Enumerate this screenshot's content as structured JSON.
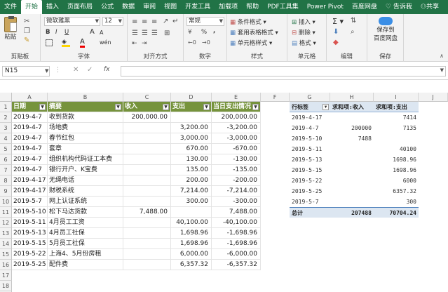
{
  "ribbon_tabs": [
    "文件",
    "开始",
    "插入",
    "页面布局",
    "公式",
    "数据",
    "审阅",
    "视图",
    "开发工具",
    "加载项",
    "帮助",
    "PDF工具集",
    "Power Pivot",
    "百度网盘",
    "告诉我",
    "共享"
  ],
  "ribbon": {
    "clipboard": {
      "paste": "粘贴",
      "label": "剪贴板"
    },
    "font": {
      "name": "微软雅黑",
      "size": "12",
      "label": "字体",
      "bold": "B",
      "italic": "I",
      "underline": "U",
      "grow": "A",
      "shrink": "A",
      "wen": "wén"
    },
    "alignment": {
      "label": "对齐方式"
    },
    "number": {
      "format": "常规",
      "label": "数字",
      "percent": "%",
      "comma": ","
    },
    "styles": {
      "cond": "条件格式",
      "table": "套用表格格式",
      "cell": "单元格样式",
      "label": "样式"
    },
    "cells": {
      "insert": "插入",
      "delete": "删除",
      "format": "格式",
      "label": "单元格"
    },
    "editing": {
      "label": "编辑",
      "sum": "Σ"
    },
    "baidu": {
      "save1": "保存到",
      "save2": "百度网盘",
      "label": "保存"
    }
  },
  "formula_bar": {
    "name_box": "N15",
    "fx": "fx",
    "value": ""
  },
  "columns": [
    "A",
    "B",
    "C",
    "D",
    "E",
    "F",
    "G",
    "H",
    "I",
    "J"
  ],
  "rows": [
    "1",
    "2",
    "3",
    "4",
    "5",
    "6",
    "7",
    "8",
    "9",
    "10",
    "11",
    "12",
    "13",
    "14",
    "15",
    "16",
    "17",
    "18",
    "19"
  ],
  "table": {
    "headers": [
      "日期",
      "摘要",
      "收入",
      "支出",
      "当日支出情况"
    ],
    "rows": [
      [
        "2019-4-7",
        "收到货款",
        "200,000.00",
        "",
        "200,000.00"
      ],
      [
        "2019-4-7",
        "场地费",
        "",
        "3,200.00",
        "-3,200.00"
      ],
      [
        "2019-4-7",
        "春节红包",
        "",
        "3,000.00",
        "-3,000.00"
      ],
      [
        "2019-4-7",
        "套章",
        "",
        "670.00",
        "-670.00"
      ],
      [
        "2019-4-7",
        "组织机构代码证工本费",
        "",
        "130.00",
        "-130.00"
      ],
      [
        "2019-4-7",
        "银行开户、K宝费",
        "",
        "135.00",
        "-135.00"
      ],
      [
        "2019-4-17",
        "无绳电话",
        "",
        "200.00",
        "-200.00"
      ],
      [
        "2019-4-17",
        "财税系统",
        "",
        "7,214.00",
        "-7,214.00"
      ],
      [
        "2019-5-7",
        "网上认证系统",
        "",
        "300.00",
        "-300.00"
      ],
      [
        "2019-5-10",
        "松下马达货款",
        "7,488.00",
        "",
        "7,488.00"
      ],
      [
        "2019-5-11",
        "4月员工工资",
        "",
        "40,100.00",
        "-40,100.00"
      ],
      [
        "2019-5-13",
        "4月员工社保",
        "",
        "1,698.96",
        "-1,698.96"
      ],
      [
        "2019-5-15",
        "5月员工社保",
        "",
        "1,698.96",
        "-1,698.96"
      ],
      [
        "2019-5-22",
        "上海4、5月份房租",
        "",
        "6,000.00",
        "-6,000.00"
      ],
      [
        "2019-5-25",
        "配件费",
        "",
        "6,357.32",
        "-6,357.32"
      ]
    ]
  },
  "pivot": {
    "headers": [
      "行标签",
      "求和项:收入",
      "求和项:支出"
    ],
    "rows": [
      [
        "2019-4-17",
        "",
        "7414"
      ],
      [
        "2019-4-7",
        "200000",
        "7135"
      ],
      [
        "2019-5-10",
        "7488",
        ""
      ],
      [
        "2019-5-11",
        "",
        "40100"
      ],
      [
        "2019-5-13",
        "",
        "1698.96"
      ],
      [
        "2019-5-15",
        "",
        "1698.96"
      ],
      [
        "2019-5-22",
        "",
        "6000"
      ],
      [
        "2019-5-25",
        "",
        "6357.32"
      ],
      [
        "2019-5-7",
        "",
        "300"
      ]
    ],
    "total": [
      "总计",
      "207488",
      "70704.24"
    ]
  },
  "colors": {
    "accent": "#217346",
    "table_header": "#76933c",
    "pivot_header": "#dce6f1"
  }
}
